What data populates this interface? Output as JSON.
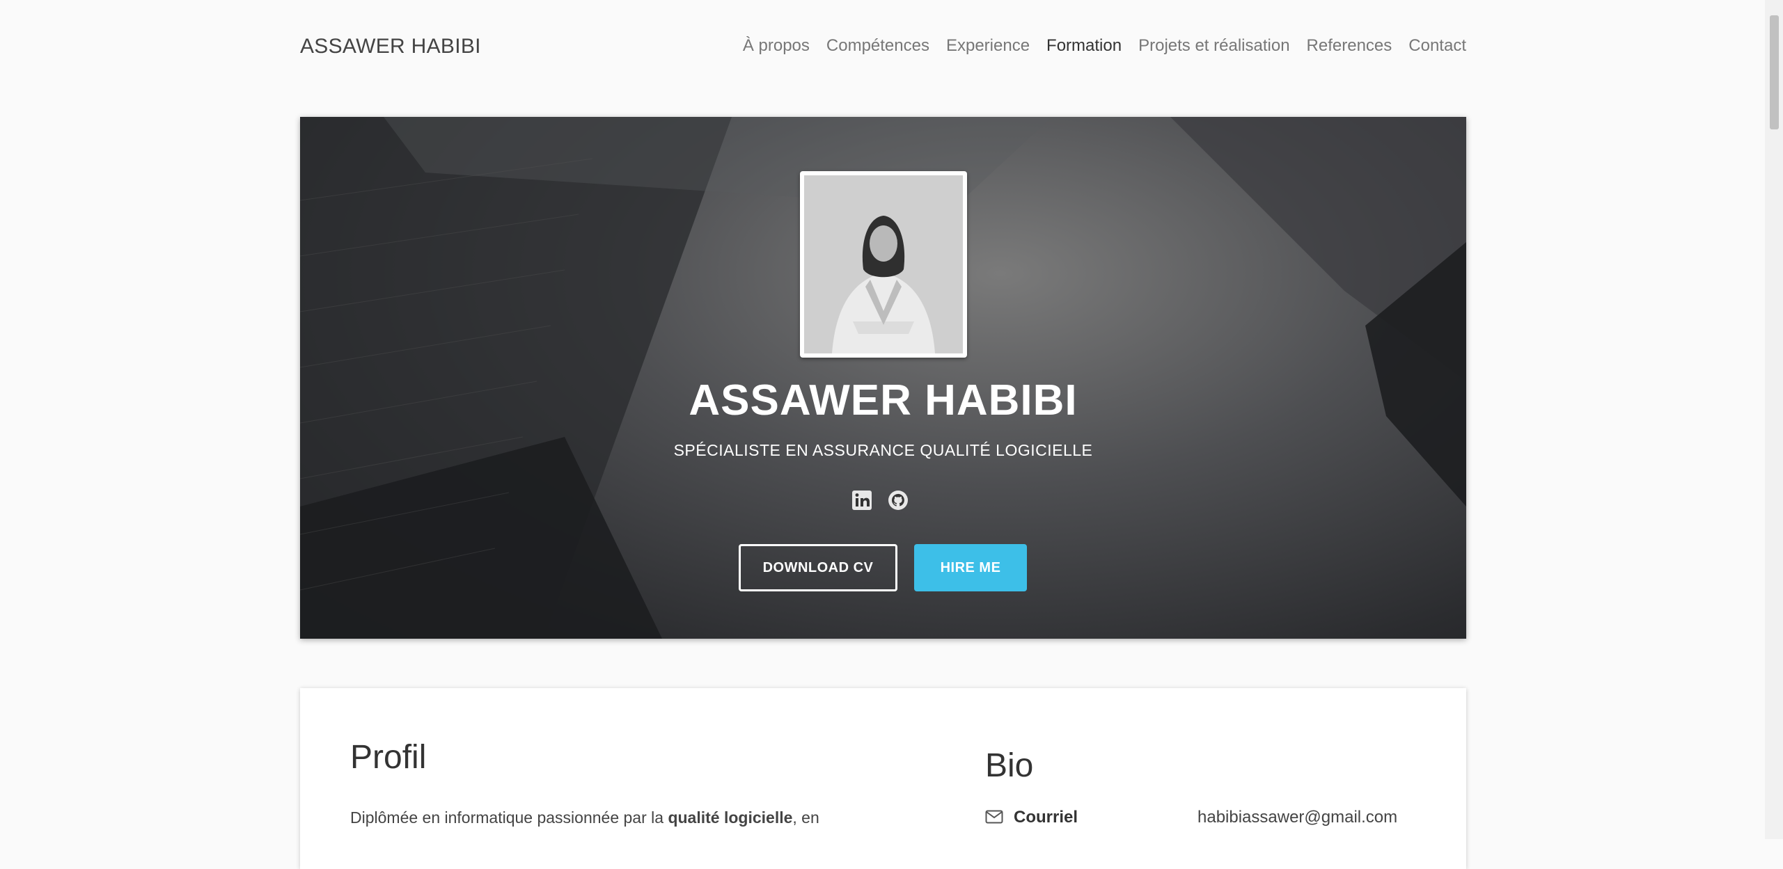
{
  "nav": {
    "brand": "ASSAWER HABIBI",
    "links": [
      {
        "label": "À propos"
      },
      {
        "label": "Compétences"
      },
      {
        "label": "Experience"
      },
      {
        "label": "Formation"
      },
      {
        "label": "Projets et réalisation"
      },
      {
        "label": "References"
      },
      {
        "label": "Contact"
      }
    ],
    "active": "Formation"
  },
  "hero": {
    "name": "ASSAWER HABIBI",
    "subtitle": "SPÉCIALISTE EN ASSURANCE QUALITÉ LOGICIELLE",
    "socials": [
      {
        "icon": "linkedin-icon"
      },
      {
        "icon": "github-icon"
      }
    ],
    "download_cv_label": "DOWNLOAD CV",
    "hire_me_label": "HIRE ME",
    "hire_color": "#3dbfe8"
  },
  "profile": {
    "title": "Profil",
    "text_start": "Diplômée en informatique passionnée par la ",
    "text_bold": "qualité logicielle",
    "text_end": ", en"
  },
  "bio": {
    "title": "Bio",
    "rows": [
      {
        "icon": "envelope-icon",
        "label": "Courriel",
        "value": "habibiassawer@gmail.com"
      }
    ]
  }
}
